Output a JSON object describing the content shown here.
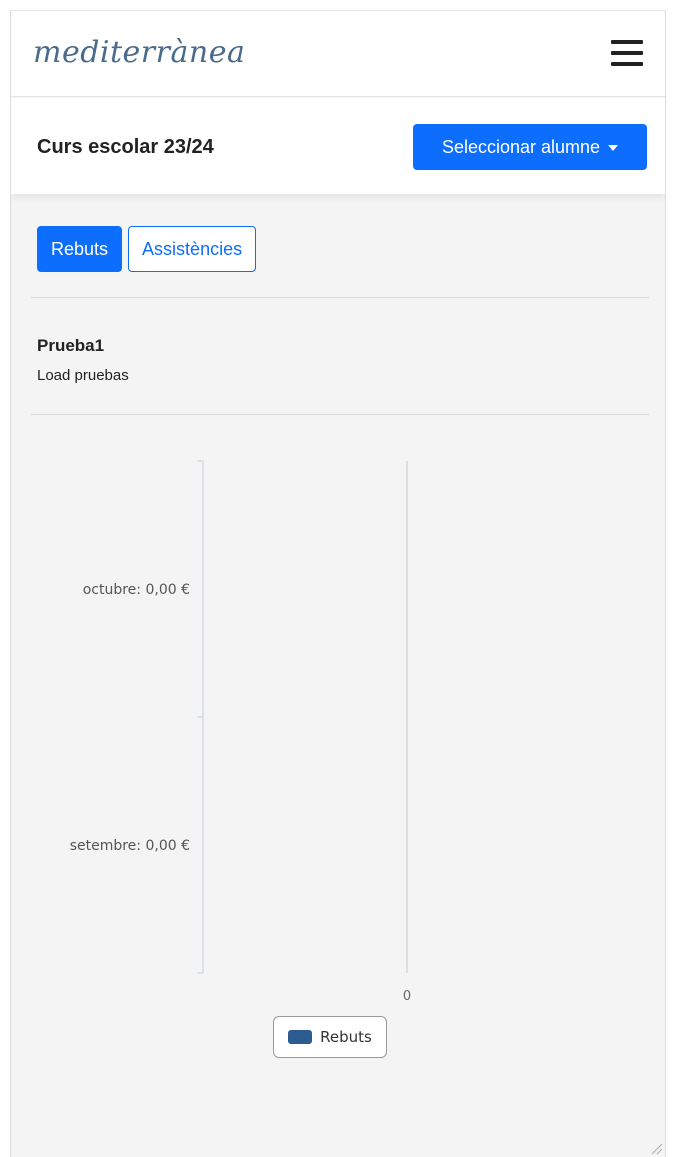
{
  "app": {
    "logo_text": "mediterrànea"
  },
  "header": {
    "school_year": "Curs escolar 23/24",
    "select_student_label": "Seleccionar alumne"
  },
  "tabs": [
    {
      "label": "Rebuts",
      "active": true
    },
    {
      "label": "Assistències",
      "active": false
    }
  ],
  "student": {
    "name": "Prueba1",
    "subtitle": "Load pruebas"
  },
  "chart_data": {
    "type": "bar",
    "orientation": "horizontal",
    "categories": [
      "octubre: 0,00 €",
      "setembre: 0,00 €"
    ],
    "series": [
      {
        "name": "Rebuts",
        "values": [
          0,
          0
        ],
        "color": "#2d5c91"
      }
    ],
    "x_ticks": [
      "0"
    ],
    "legend_position": "bottom"
  }
}
